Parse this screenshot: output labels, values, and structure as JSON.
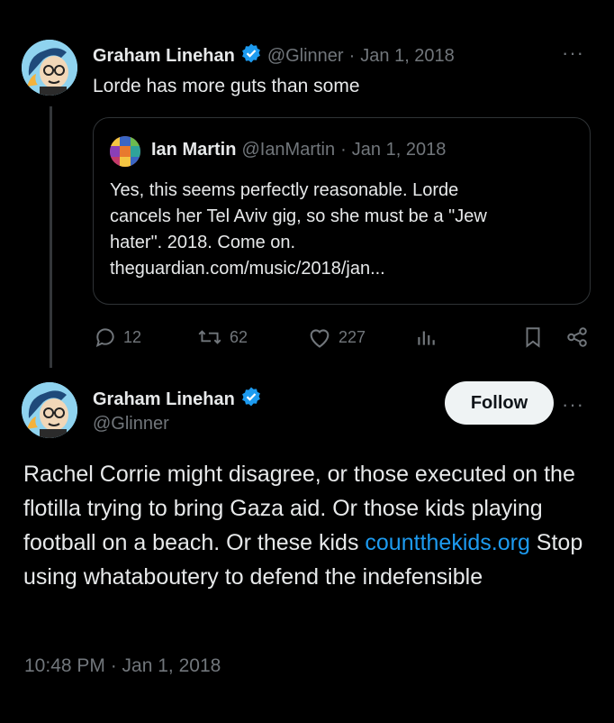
{
  "parent_tweet": {
    "display_name": "Graham Linehan",
    "handle": "@Glinner",
    "separator": "·",
    "date": "Jan 1, 2018",
    "more": "···",
    "text": "Lorde has more guts than some",
    "quoted": {
      "display_name": "Ian Martin",
      "handle": "@IanMartin",
      "separator": "·",
      "date": "Jan 1, 2018",
      "lines": [
        "Yes, this seems perfectly reasonable. Lorde",
        "cancels her Tel Aviv gig, so she must be a \"Jew",
        "hater\". 2018. Come on.",
        "theguardian.com/music/2018/jan..."
      ]
    },
    "actions": {
      "replies": "12",
      "retweets": "62",
      "likes": "227"
    }
  },
  "main_tweet": {
    "display_name": "Graham Linehan",
    "handle": "@Glinner",
    "follow_label": "Follow",
    "more": "···",
    "text_before_link": "Rachel Corrie might disagree, or those executed on the flotilla trying to bring Gaza aid. Or those kids playing football on a beach. Or these kids ",
    "link_text": "countthekids.org",
    "text_after_link": " Stop using whataboutery to defend the indefensible",
    "timestamp": "10:48 PM · Jan 1, 2018"
  },
  "colors": {
    "background": "#000000",
    "text": "#e7e9ea",
    "muted": "#71767b",
    "link": "#1d9bf0",
    "verified": "#1d9bf0"
  }
}
